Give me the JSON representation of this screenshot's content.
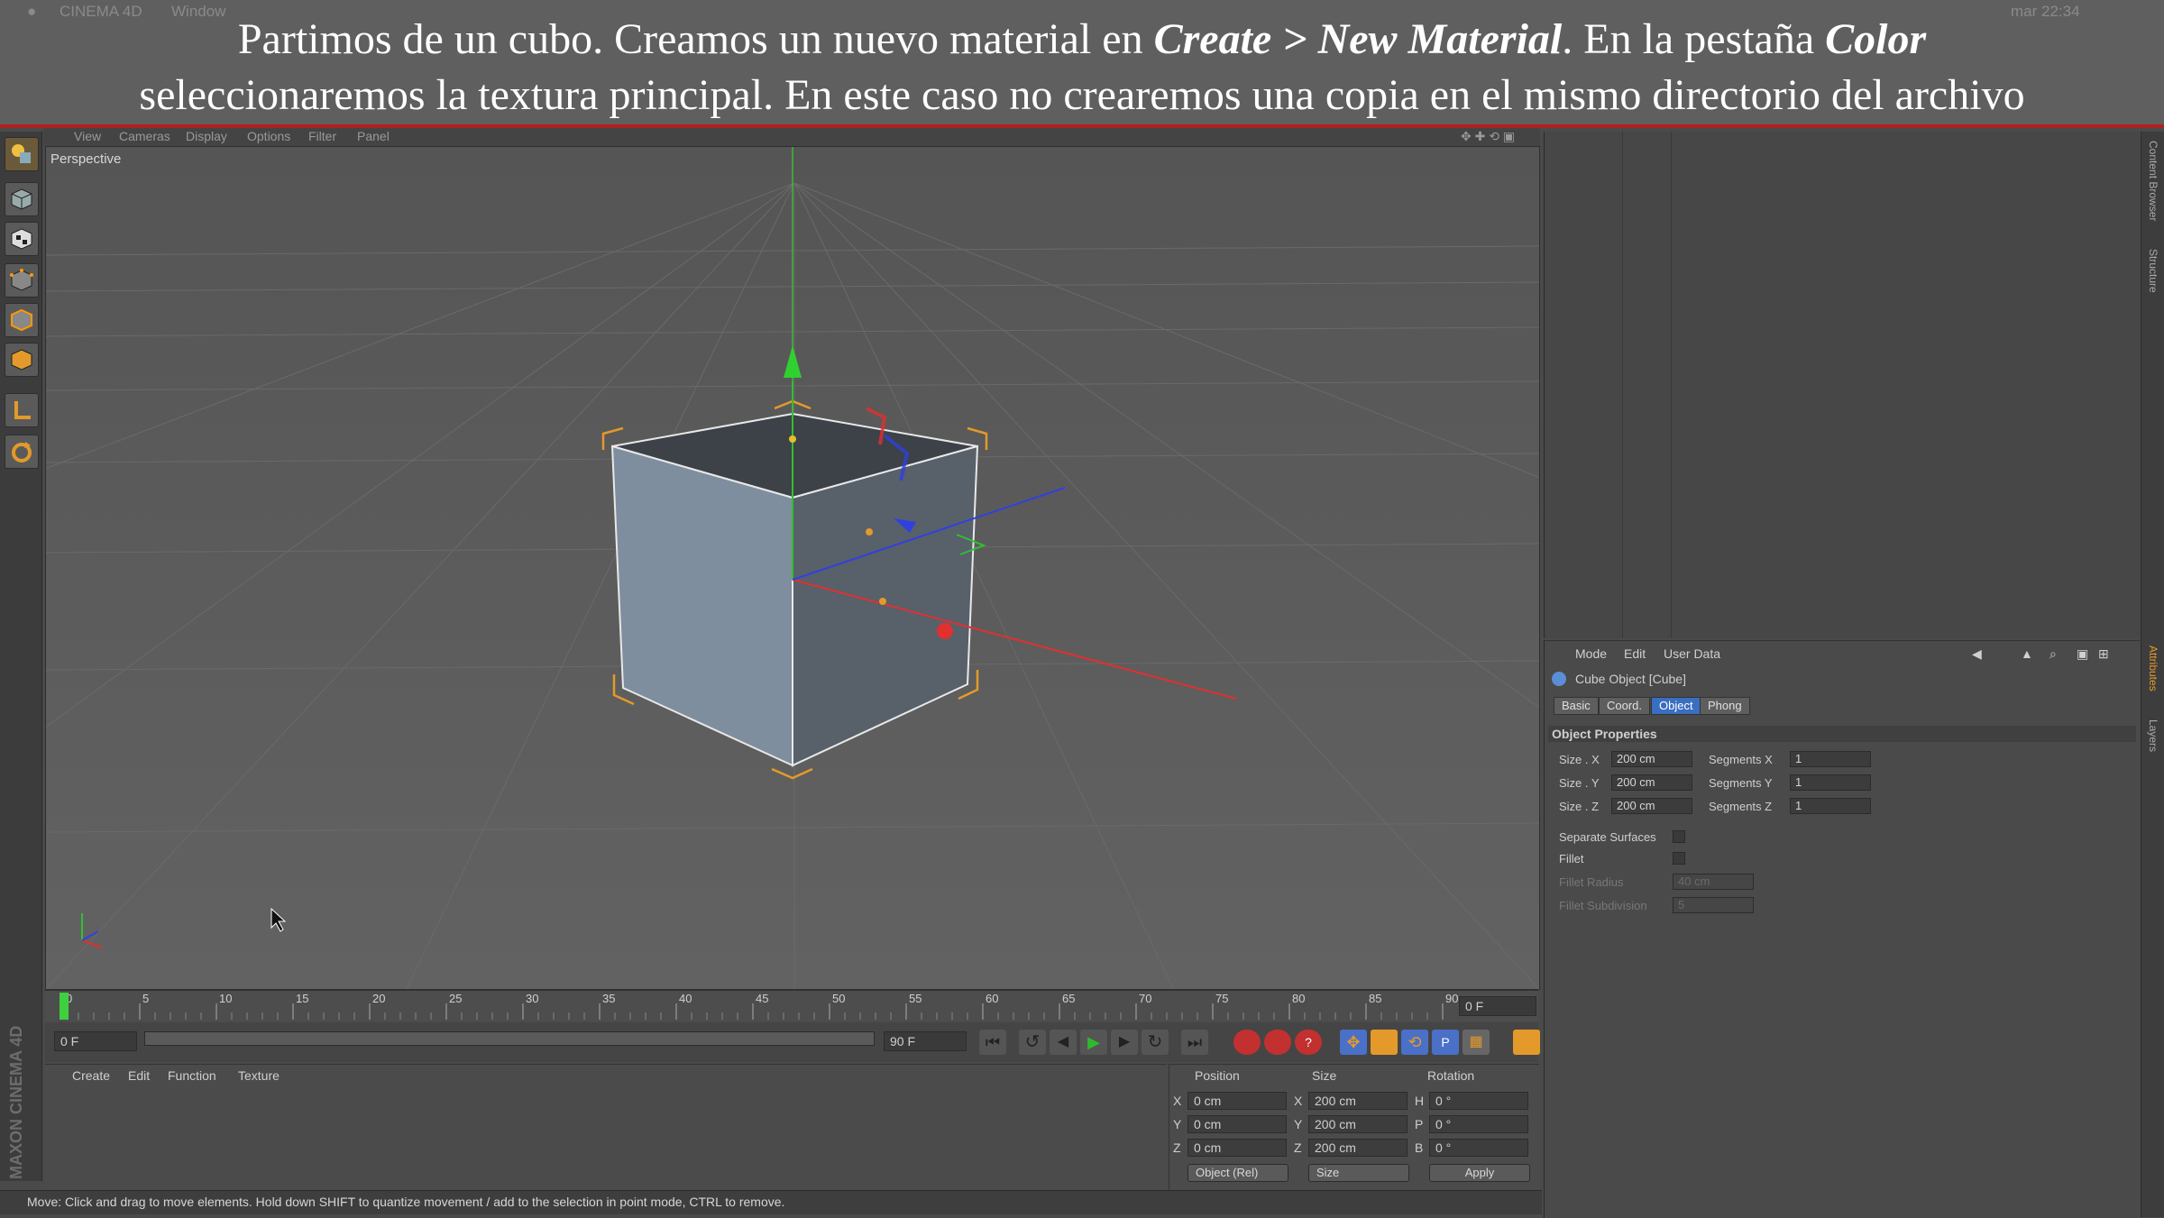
{
  "app": {
    "title": "CINEMA 4D",
    "menu_window": "Window",
    "clock": "mar 22:34"
  },
  "caption": {
    "line1_a": "Partimos de un cubo. Creamos un nuevo material en ",
    "line1_em1": "Create > New Material",
    "line1_b": ". En la pestaña ",
    "line1_em2": "Color",
    "line2": "seleccionaremos la textura principal. En este caso no crearemos una copia en el mismo directorio del archivo"
  },
  "viewport": {
    "menu": [
      "View",
      "Cameras",
      "Display",
      "Options",
      "Filter",
      "Panel"
    ],
    "label": "Perspective"
  },
  "timeline": {
    "ticks": [
      "0",
      "5",
      "10",
      "15",
      "20",
      "25",
      "30",
      "35",
      "40",
      "45",
      "50",
      "55",
      "60",
      "65",
      "70",
      "75",
      "80",
      "85",
      "90"
    ],
    "current_frame": "0 F",
    "start_field": "0 F",
    "end_field": "90 F",
    "range_end": "90 F"
  },
  "material_manager": {
    "menu": [
      "Create",
      "Edit",
      "Function",
      "Texture"
    ]
  },
  "coordinates": {
    "headers": [
      "Position",
      "Size",
      "Rotation"
    ],
    "rows": [
      {
        "axis": "X",
        "pos": "0 cm",
        "size_axis": "X",
        "size": "200 cm",
        "rot_axis": "H",
        "rot": "0 °"
      },
      {
        "axis": "Y",
        "pos": "0 cm",
        "size_axis": "Y",
        "size": "200 cm",
        "rot_axis": "P",
        "rot": "0 °"
      },
      {
        "axis": "Z",
        "pos": "0 cm",
        "size_axis": "Z",
        "size": "200 cm",
        "rot_axis": "B",
        "rot": "0 °"
      }
    ],
    "mode_select": "Object (Rel)",
    "size_select": "Size",
    "apply_label": "Apply"
  },
  "status_bar": {
    "text": "Move: Click and drag to move elements. Hold down SHIFT to quantize movement / add to the selection in point mode, CTRL to remove."
  },
  "attributes": {
    "menu": [
      "Mode",
      "Edit",
      "User Data"
    ],
    "object_title": "Cube Object [Cube]",
    "tabs": [
      "Basic",
      "Coord.",
      "Object",
      "Phong"
    ],
    "section": "Object Properties",
    "size_x_label": "Size . X",
    "size_x": "200 cm",
    "size_y_label": "Size . Y",
    "size_y": "200 cm",
    "size_z_label": "Size . Z",
    "size_z": "200 cm",
    "seg_x_label": "Segments X",
    "seg_x": "1",
    "seg_y_label": "Segments Y",
    "seg_y": "1",
    "seg_z_label": "Segments Z",
    "seg_z": "1",
    "separate_label": "Separate Surfaces",
    "fillet_label": "Fillet",
    "fillet_radius_label": "Fillet Radius",
    "fillet_radius": "40 cm",
    "fillet_sub_label": "Fillet Subdivision",
    "fillet_sub": "5"
  },
  "side_tabs": [
    "Content Browser",
    "Structure",
    "Attributes",
    "Layers"
  ],
  "maxon_logo": "MAXON CINEMA 4D",
  "colors": {
    "caption_rule": "#b21f1f",
    "selection_orange": "#e39a2a",
    "axis_x": "#e03030",
    "axis_y": "#30c030",
    "axis_z": "#3040e0",
    "active_tab": "#3a6ec0"
  }
}
